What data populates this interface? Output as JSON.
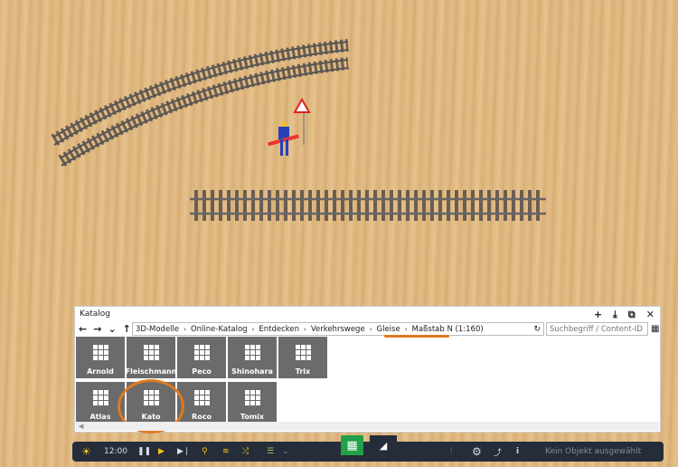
{
  "catalog": {
    "title": "Katalog",
    "add": "+",
    "download": "⤓",
    "popout": "⧉",
    "close": "✕",
    "nav": {
      "back": "←",
      "forward": "→",
      "down": "⌄",
      "up": "↑"
    },
    "breadcrumb": [
      "3D-Modelle",
      "Online-Katalog",
      "Entdecken",
      "Verkehrswege",
      "Gleise",
      "Maßstab N (1:160)"
    ],
    "refresh": "↻",
    "search_placeholder": "Suchbegriff / Content-ID",
    "tiles": [
      "Arnold",
      "Fleischmann",
      "Peco",
      "Shinohara",
      "Trix",
      "Atlas",
      "Kato",
      "Roco",
      "Tomix"
    ],
    "highlighted_tile": "Kato",
    "accent": "#e07a1f"
  },
  "toolbar": {
    "time": "12:00",
    "status": "Kein Objekt ausgewählt"
  }
}
